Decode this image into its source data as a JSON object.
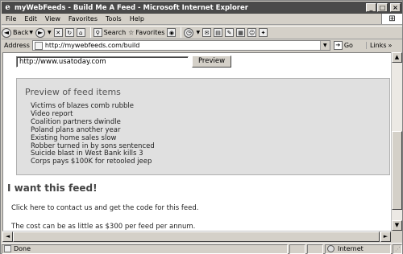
{
  "window": {
    "title": "myWebFeeds - Build Me A Feed - Microsoft Internet Explorer",
    "app_icon": "ie-e-icon"
  },
  "menu": [
    "File",
    "Edit",
    "View",
    "Favorites",
    "Tools",
    "Help"
  ],
  "toolbar": {
    "back_label": "Back",
    "search_label": "Search",
    "favorites_label": "Favorites"
  },
  "address": {
    "label": "Address",
    "url": "http://mywebfeeds.com/build",
    "go_label": "Go",
    "links_label": "Links"
  },
  "page": {
    "url_input_value": "http://www.usatoday.com",
    "preview_button": "Preview",
    "preview_heading": "Preview of feed items",
    "feed_items": [
      "Victims of blazes comb rubble",
      "Video report",
      "Coalition partners dwindle",
      "Poland plans another year",
      "Existing home sales slow",
      "Robber turned in by sons sentenced",
      "Suicide blast in West Bank kills 3",
      "Corps pays $100K for retooled jeep"
    ],
    "want_heading": "I want this feed!",
    "contact_text": "Click here to contact us and get the code for this feed.",
    "cost_text": "The cost can be as little as $300 per feed per annum."
  },
  "status": {
    "left_text": "Done",
    "zone_text": "Internet"
  }
}
